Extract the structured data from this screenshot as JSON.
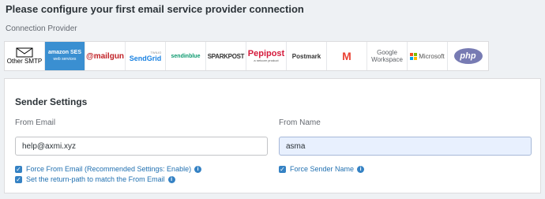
{
  "page": {
    "title": "Please configure your first email service provider connection",
    "provider_label": "Connection Provider"
  },
  "providers": [
    {
      "label": "Other SMTP",
      "icon": "envelope-icon",
      "selected": false
    },
    {
      "label": "amazon SES",
      "sub": "web services",
      "selected": true
    },
    {
      "label": "@mailgun",
      "selected": false
    },
    {
      "label": "SendGrid",
      "sub": "TWILIO",
      "selected": false
    },
    {
      "label": "sendinblue",
      "selected": false
    },
    {
      "label": "SPARKPOST",
      "selected": false
    },
    {
      "label": "Pepipost",
      "sub": "a netcore product",
      "selected": false
    },
    {
      "label": "Postmark",
      "selected": false
    },
    {
      "label": "M",
      "icon": "gmail-icon",
      "selected": false
    },
    {
      "label": "Google",
      "sub": "Workspace",
      "selected": false
    },
    {
      "label": "Microsoft",
      "icon": "microsoft-logo-icon",
      "selected": false
    },
    {
      "label": "php",
      "selected": false
    }
  ],
  "sender": {
    "title": "Sender Settings",
    "from_email_label": "From Email",
    "from_email_value": "help@axmi.xyz",
    "from_name_label": "From Name",
    "from_name_value": "asma",
    "force_from_email": "Force From Email (Recommended Settings: Enable)",
    "return_path": "Set the return-path to match the From Email",
    "force_sender_name": "Force Sender Name"
  },
  "colors": {
    "accent": "#3582c4",
    "selected_tile": "#3a8fd1",
    "background": "#eef1f4"
  }
}
